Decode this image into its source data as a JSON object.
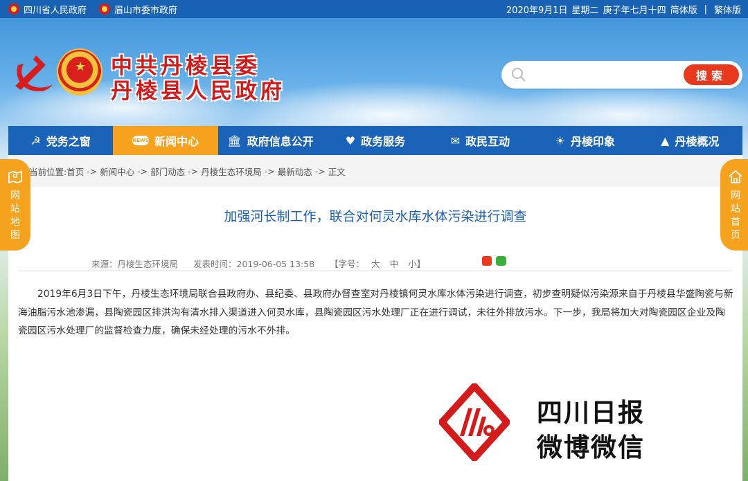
{
  "topbar": {
    "link1": "四川省人民政府",
    "link2": "眉山市委市政府",
    "date": "2020年9月1日",
    "weekday": "星期二",
    "lunar": "庚子年七月十四",
    "simplified": "简体版",
    "separator": "|",
    "traditional": "繁体版"
  },
  "header": {
    "title_line1": "中共丹棱县委",
    "title_line2": "丹棱县人民政府"
  },
  "search": {
    "placeholder": "",
    "value": "",
    "button": "搜索"
  },
  "nav": {
    "items": [
      {
        "label": "党务之窗",
        "icon": "party-icon"
      },
      {
        "label": "新闻中心",
        "icon": "news-icon",
        "badge": "NEWS"
      },
      {
        "label": "政府信息公开",
        "icon": "government-building-icon"
      },
      {
        "label": "政务服务",
        "icon": "service-hands-icon"
      },
      {
        "label": "政民互动",
        "icon": "chat-icon"
      },
      {
        "label": "丹棱印象",
        "icon": "landscape-icon"
      },
      {
        "label": "丹棱概况",
        "icon": "mountain-icon"
      }
    ]
  },
  "side": {
    "left_chars": [
      "网",
      "站",
      "地",
      "图"
    ],
    "right_chars": [
      "网",
      "站",
      "首",
      "页"
    ]
  },
  "breadcrumb": {
    "prefix": "当前位置:",
    "items": [
      "首页",
      "新闻中心",
      "部门动态",
      "丹棱生态环境局",
      "最新动态",
      "正文"
    ],
    "arrow": "->"
  },
  "article": {
    "title": "加强河长制工作，联合对何灵水库水体污染进行调查",
    "source": "来源：丹棱生态环境局",
    "published": "发表时间：2019-06-05 13:58",
    "fontsize_label": "【字号：",
    "size_large": "大",
    "size_medium": "中",
    "size_small": "小】",
    "body": "2019年6月3日下午，丹棱生态环境局联合县政府办、县纪委、县政府办督查室对丹棱镇何灵水库水体污染进行调查，初步查明疑似污染源来自于丹棱县华盛陶瓷与新海油脂污水池渗漏，县陶瓷园区排洪沟有清水排入渠道进入何灵水库，县陶瓷园区污水处理厂正在进行调试，未往外排放污水。下一步，我局将加大对陶瓷园区企业及陶瓷园区污水处理厂的监督检查力度，确保未经处理的污水不外排。"
  },
  "promo": {
    "line1": "四川日报",
    "line2": "微博微信"
  },
  "colors": {
    "nav_blue": "#1b63b8",
    "accent_orange": "#f7a21e",
    "title_red": "#d11b1b",
    "link_blue": "#1b5fb3",
    "search_red": "#e8381e"
  }
}
